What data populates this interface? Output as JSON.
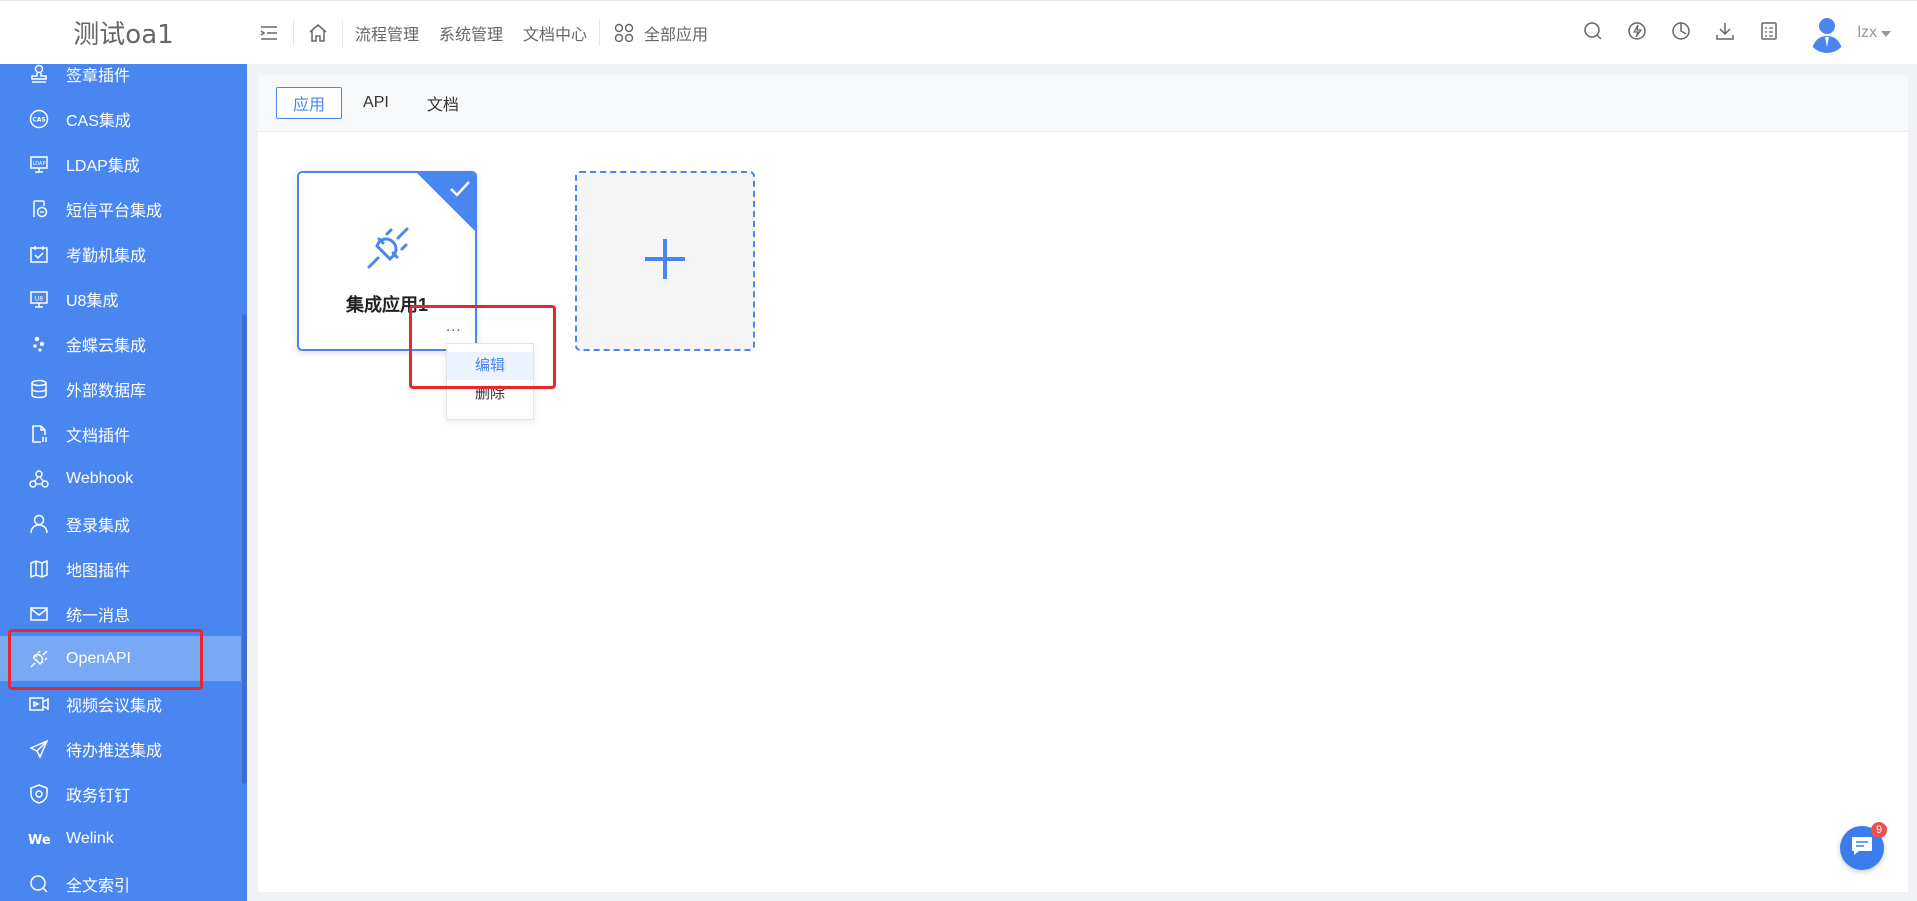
{
  "header": {
    "logo": "测试oa1",
    "nav": [
      {
        "label": "流程管理"
      },
      {
        "label": "系统管理"
      },
      {
        "label": "文档中心"
      },
      {
        "label": "全部应用"
      }
    ],
    "user": "lzx"
  },
  "sidebar": {
    "items": [
      {
        "label": "签章插件",
        "icon": "stamp-icon"
      },
      {
        "label": "CAS集成",
        "icon": "cas-icon"
      },
      {
        "label": "LDAP集成",
        "icon": "ldap-icon"
      },
      {
        "label": "短信平台集成",
        "icon": "sms-icon"
      },
      {
        "label": "考勤机集成",
        "icon": "calendar-check-icon"
      },
      {
        "label": "U8集成",
        "icon": "u8-icon"
      },
      {
        "label": "金蝶云集成",
        "icon": "dots-icon"
      },
      {
        "label": "外部数据库",
        "icon": "database-icon"
      },
      {
        "label": "文档插件",
        "icon": "document-icon"
      },
      {
        "label": "Webhook",
        "icon": "webhook-icon"
      },
      {
        "label": "登录集成",
        "icon": "user-icon"
      },
      {
        "label": "地图插件",
        "icon": "map-icon"
      },
      {
        "label": "统一消息",
        "icon": "mail-icon"
      },
      {
        "label": "OpenAPI",
        "icon": "plug-icon"
      },
      {
        "label": "视频会议集成",
        "icon": "video-icon"
      },
      {
        "label": "待办推送集成",
        "icon": "send-icon"
      },
      {
        "label": "政务钉钉",
        "icon": "shield-icon"
      },
      {
        "label": "Welink",
        "icon": "welink-icon"
      },
      {
        "label": "全文索引",
        "icon": "search-icon"
      }
    ]
  },
  "tabs": [
    {
      "label": "应用"
    },
    {
      "label": "API"
    },
    {
      "label": "文档"
    }
  ],
  "app_card": {
    "name": "集成应用1",
    "more": "..."
  },
  "dropdown": {
    "edit": "编辑",
    "delete": "删除"
  },
  "chat": {
    "badge": "9"
  },
  "colors": {
    "primary": "#4a86f0",
    "sidebar_active": "#79a8f5",
    "highlight": "#e8262b"
  }
}
